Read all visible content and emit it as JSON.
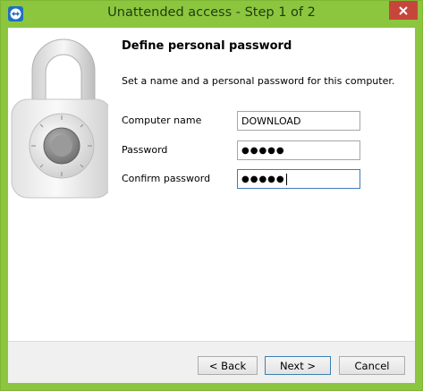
{
  "window": {
    "title": "Unattended access - Step 1 of 2",
    "icons": {
      "app": "teamviewer-icon",
      "close": "close-icon"
    },
    "colors": {
      "frame": "#8cc63f",
      "close": "#c7463b"
    }
  },
  "content": {
    "heading": "Define personal password",
    "description": "Set a name and a personal password for this computer.",
    "image": "padlock-icon"
  },
  "form": {
    "computer_name": {
      "label": "Computer name",
      "value": "DOWNLOAD"
    },
    "password": {
      "label": "Password",
      "value": "●●●●●"
    },
    "confirm_password": {
      "label": "Confirm password",
      "value": "●●●●●"
    }
  },
  "buttons": {
    "back": "< Back",
    "next": "Next >",
    "cancel": "Cancel"
  }
}
